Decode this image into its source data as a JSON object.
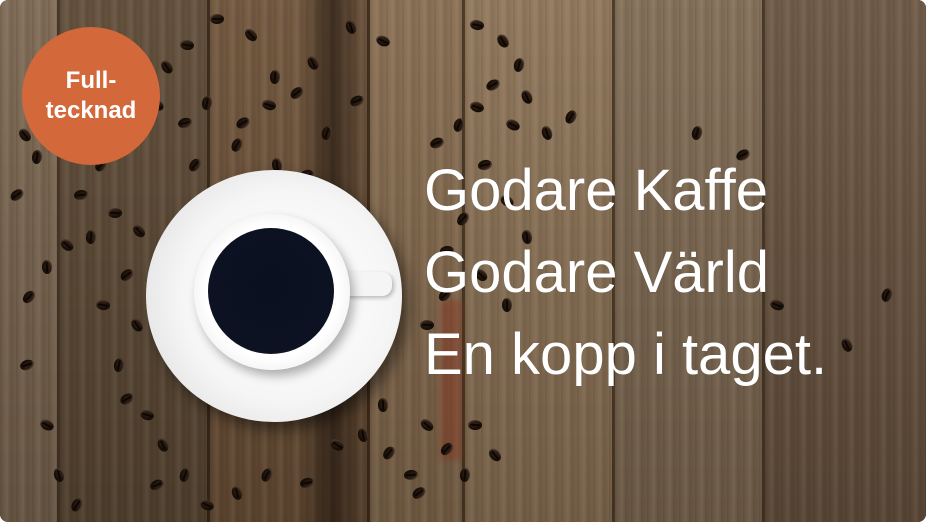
{
  "badge": {
    "line1": "Full-",
    "line2": "tecknad",
    "color": "#d3683b"
  },
  "headline": {
    "line1": "Godare Kaffe",
    "line2": "Godare Värld",
    "line3": "En kopp i taget."
  },
  "colors": {
    "text": "#ffffff",
    "wood": "#7a5f44",
    "coffee": "#0c1222"
  }
}
